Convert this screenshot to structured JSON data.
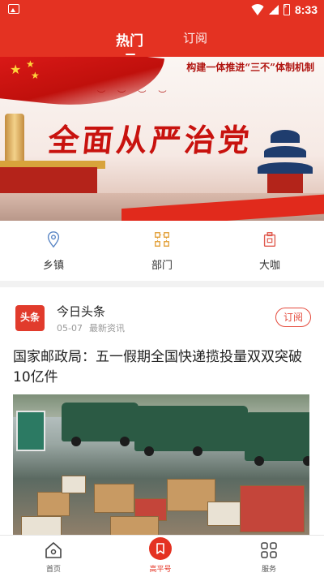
{
  "status_bar": {
    "time": "8:33"
  },
  "header": {
    "tabs": [
      {
        "label": "热门",
        "active": true
      },
      {
        "label": "订阅",
        "active": false
      }
    ],
    "accent_color": "#e43222"
  },
  "banner": {
    "slogan": "构建一体推进“三不”体制机制",
    "title": "全面从严治党"
  },
  "quick_nav": [
    {
      "label": "乡镇",
      "icon": "location-pin-icon"
    },
    {
      "label": "部门",
      "icon": "org-chart-icon"
    },
    {
      "label": "大咖",
      "icon": "badge-icon"
    }
  ],
  "news": {
    "source_logo_text": "头条",
    "source_name": "今日头条",
    "date": "05-07",
    "category": "最新资讯",
    "subscribe_label": "订阅",
    "headline": "国家邮政局：五一假期全国快递揽投量双双突破10亿件"
  },
  "bottom_nav": [
    {
      "label": "首页",
      "icon": "home-icon",
      "active": false
    },
    {
      "label": "高平号",
      "icon": "bookmark-icon",
      "active": true
    },
    {
      "label": "服务",
      "icon": "grid-icon",
      "active": false
    }
  ]
}
